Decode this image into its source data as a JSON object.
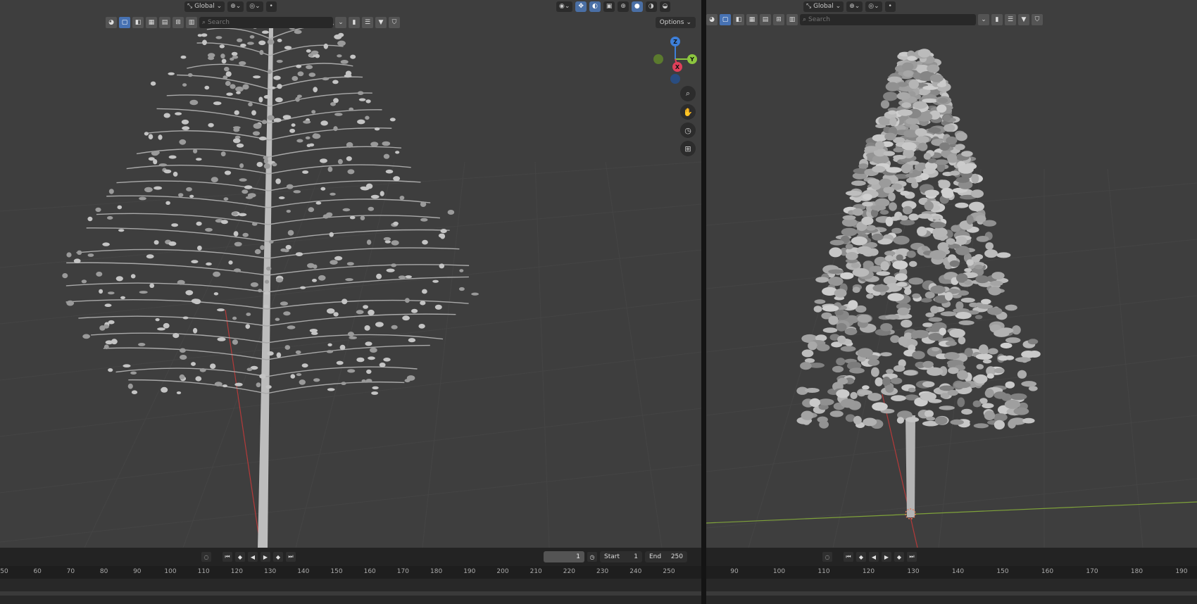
{
  "left": {
    "header": {
      "orientation": "Global"
    },
    "search_placeholder": "Search",
    "options_label": "Options",
    "gizmo": {
      "z": "Z",
      "y": "Y",
      "x": "X"
    },
    "icons": [
      "zoom-icon",
      "hand-pan-icon",
      "camera-icon",
      "grid-icon"
    ],
    "timeline": {
      "current_frame": "1",
      "start_label": "Start",
      "start_value": "1",
      "end_label": "End",
      "end_value": "250",
      "ticks": [
        "50",
        "60",
        "70",
        "80",
        "90",
        "100",
        "110",
        "120",
        "130",
        "140",
        "150",
        "160",
        "170",
        "180",
        "190",
        "200",
        "210",
        "220",
        "230",
        "240",
        "250"
      ]
    }
  },
  "right": {
    "header": {
      "orientation": "Global"
    },
    "search_placeholder": "Search",
    "timeline": {
      "ticks": [
        "90",
        "100",
        "110",
        "120",
        "130",
        "140",
        "150",
        "160",
        "170",
        "180",
        "190"
      ]
    }
  },
  "colors": {
    "viewport_bg": "#3e3e3e",
    "accent": "#4772b3",
    "axis_x": "#e0405a",
    "axis_y": "#8cc63f",
    "axis_z": "#3d7fd9"
  }
}
